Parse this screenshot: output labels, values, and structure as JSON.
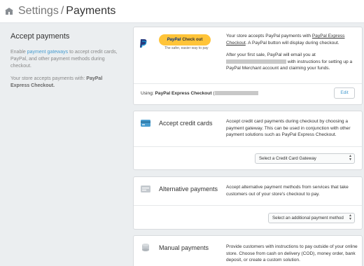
{
  "header": {
    "section": "Settings",
    "separator": "/",
    "page": "Payments"
  },
  "sidebar": {
    "heading": "Accept payments",
    "intro_prefix": "Enable ",
    "intro_link": "payment gateways",
    "intro_suffix": " to accept credit cards, PayPal, and other payment methods during checkout.",
    "status_prefix": "Your store accepts payments with: ",
    "status_value": "PayPal Express Checkout."
  },
  "paypal": {
    "button_brand": "PayPal",
    "button_action": "Check out",
    "tagline": "The safer, easier way to pay",
    "desc1_prefix": "Your store accepts PayPal payments with ",
    "desc1_link": "PayPal Express Checkout",
    "desc1_suffix": ". A PayPal button will display during checkout.",
    "desc2_prefix": "After your first sale, PayPal will email you at",
    "desc2_suffix": "with instructions for setting up a PayPal Merchant account and claiming your funds.",
    "using_label": "Using: ",
    "using_value": "PayPal Express Checkout",
    "using_paren": "(",
    "edit_label": "Edit"
  },
  "credit_cards": {
    "title": "Accept credit cards",
    "desc": "Accept credit card payments during checkout by choosing a payment gateway. This can be used in conjunction with other payment solutions such as PayPal Express Checkout.",
    "select_value": "Select a Credit Card Gateway"
  },
  "alternative": {
    "title": "Alternative payments",
    "desc": "Accept alternative payment methods from services that take customers out of your store's checkout to pay.",
    "select_value": "Select an additional payment method"
  },
  "manual": {
    "title": "Manual payments",
    "desc": "Provide customers with instructions to pay outside of your online store. Choose from cash on delivery (COD), money order, bank deposit, or create a custom solution."
  },
  "colors": {
    "link": "#479ccf",
    "paypal_yellow": "#ffc439",
    "paypal_blue": "#003087",
    "background": "#ebeef0"
  }
}
